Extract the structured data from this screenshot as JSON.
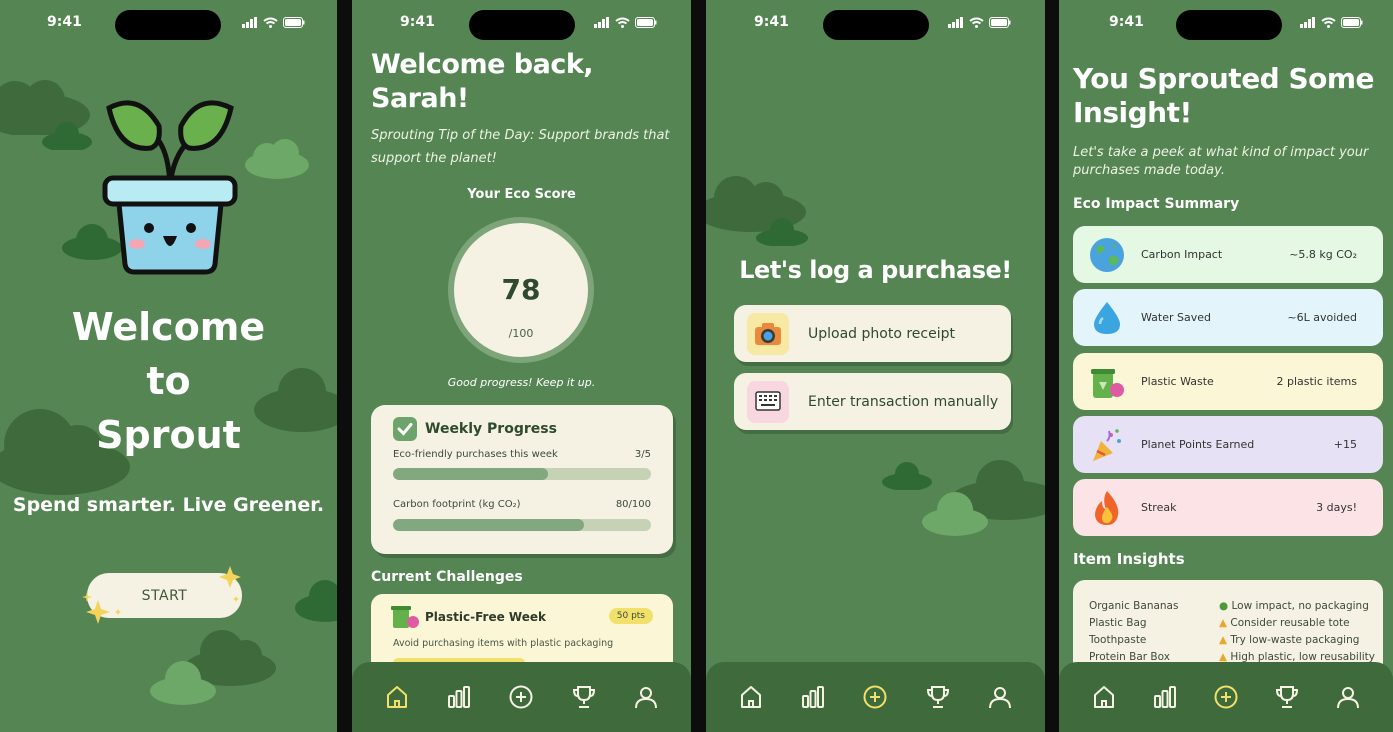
{
  "status": {
    "time": "9:41"
  },
  "colors": {
    "bg": "#548552",
    "cream": "#f5f1e3",
    "accent": "#f1e06a"
  },
  "screen1": {
    "title_line1": "Welcome",
    "title_line2": "to",
    "title_line3": "Sprout",
    "tagline": "Spend smarter. Live Greener.",
    "start_label": "START",
    "mascot_icon": "plant-pot-mascot-icon"
  },
  "screen2": {
    "greeting_line1": "Welcome back,",
    "greeting_line2": "Sarah!",
    "tip": "Sprouting Tip of the Day: Support brands that support the planet!",
    "eco_score_label": "Your Eco Score",
    "eco_score": "78",
    "eco_score_max": "/100",
    "eco_score_fraction": 0.78,
    "progress_note": "Good progress! Keep it up.",
    "weekly": {
      "title": "Weekly Progress",
      "rows": [
        {
          "label": "Eco-friendly purchases this week",
          "value": "3/5",
          "fraction": 0.6
        },
        {
          "label": "Carbon footprint (kg CO₂)",
          "value": "80/100",
          "fraction": 0.74
        }
      ]
    },
    "challenges_label": "Current Challenges",
    "challenge": {
      "title": "Plastic-Free Week",
      "points": "50 pts",
      "desc": "Avoid purchasing items with plastic packaging"
    }
  },
  "screen3": {
    "title": "Let's log a purchase!",
    "upload_label": "Upload photo receipt",
    "manual_label": "Enter transaction manually"
  },
  "screen4": {
    "title_line1": "You Sprouted Some",
    "title_line2": "Insight!",
    "subtitle": "Let's take a peek at what kind of impact your purchases made today.",
    "summary_label": "Eco Impact Summary",
    "impacts": [
      {
        "name": "Carbon Impact",
        "value": "~5.8 kg CO₂",
        "icon": "earth-icon",
        "color": "#e4f8e4"
      },
      {
        "name": "Water Saved",
        "value": "~6L avoided",
        "icon": "water-drop-icon",
        "color": "#e3f5fb"
      },
      {
        "name": "Plastic Waste",
        "value": "2 plastic items",
        "icon": "recycle-bin-icon",
        "color": "#fbf6d6"
      },
      {
        "name": "Planet Points Earned",
        "value": "+15",
        "icon": "party-popper-icon",
        "color": "#e6e1f4"
      },
      {
        "name": "Streak",
        "value": "3 days!",
        "icon": "fire-icon",
        "color": "#fbe3e6"
      }
    ],
    "items_label": "Item Insights",
    "items": [
      {
        "name": "Organic Bananas",
        "insight": "Low impact, no packaging"
      },
      {
        "name": "Plastic Bag",
        "insight": "Consider reusable tote"
      },
      {
        "name": "Toothpaste",
        "insight": "Try low-waste packaging"
      },
      {
        "name": "Protein Bar Box",
        "insight": "High plastic, low reusability"
      }
    ]
  },
  "nav": [
    "home-icon",
    "stats-icon",
    "add-icon",
    "trophy-icon",
    "profile-icon"
  ]
}
